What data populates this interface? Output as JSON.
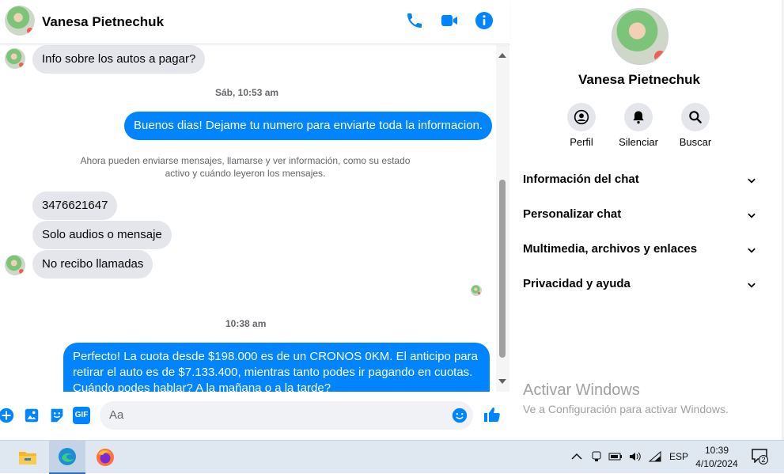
{
  "header": {
    "contact_name": "Vanesa Pietnechuk",
    "icons": [
      "phone-icon",
      "video-icon",
      "info-icon"
    ],
    "accent": "#0084ff"
  },
  "messages": {
    "first_incoming": "Info sobre los autos a pagar?",
    "timestamp_1": "Sáb, 10:53 am",
    "outgoing_1": "Buenos dias! Dejame tu numero para enviarte toda la informacion.",
    "system_notice_line1": "Ahora pueden enviarse mensajes, llamarse y ver información, como su estado",
    "system_notice_line2": "activo y cuándo leyeron los mensajes.",
    "incoming_phone": "3476621647",
    "incoming_audio": "Solo audios o mensaje",
    "incoming_calls": "No recibo llamadas",
    "timestamp_2": "10:38 am",
    "outgoing_2_line1": "Perfecto! La cuota desde $198.000 es de un CRONOS 0KM. El anticipo para",
    "outgoing_2_line2": "retirar el auto es de $7.133.400, mientras tanto podes ir pagando en cuotas.",
    "outgoing_2_line3": "Cuándo podes hablar? A la mañana o a la tarde?"
  },
  "composer": {
    "placeholder": "Aa",
    "gif_label": "GIF",
    "icons": [
      "plus-icon",
      "image-icon",
      "sticker-icon",
      "gif-icon",
      "emoji-icon",
      "like-icon"
    ]
  },
  "info_panel": {
    "name": "Vanesa Pietnechuk",
    "actions": [
      {
        "label": "Perfil",
        "icon": "profile-icon"
      },
      {
        "label": "Silenciar",
        "icon": "bell-icon"
      },
      {
        "label": "Buscar",
        "icon": "search-icon"
      }
    ],
    "sections": [
      "Información del chat",
      "Personalizar chat",
      "Multimedia, archivos y enlaces",
      "Privacidad y ayuda"
    ]
  },
  "watermark": {
    "title": "Activar Windows",
    "subtitle": "Ve a Configuración para activar Windows."
  },
  "taskbar": {
    "apps": [
      "file-explorer-icon",
      "edge-icon",
      "firefox-icon"
    ],
    "language": "ESP",
    "time": "10:39",
    "date": "4/10/2024",
    "notification_count": "2"
  }
}
